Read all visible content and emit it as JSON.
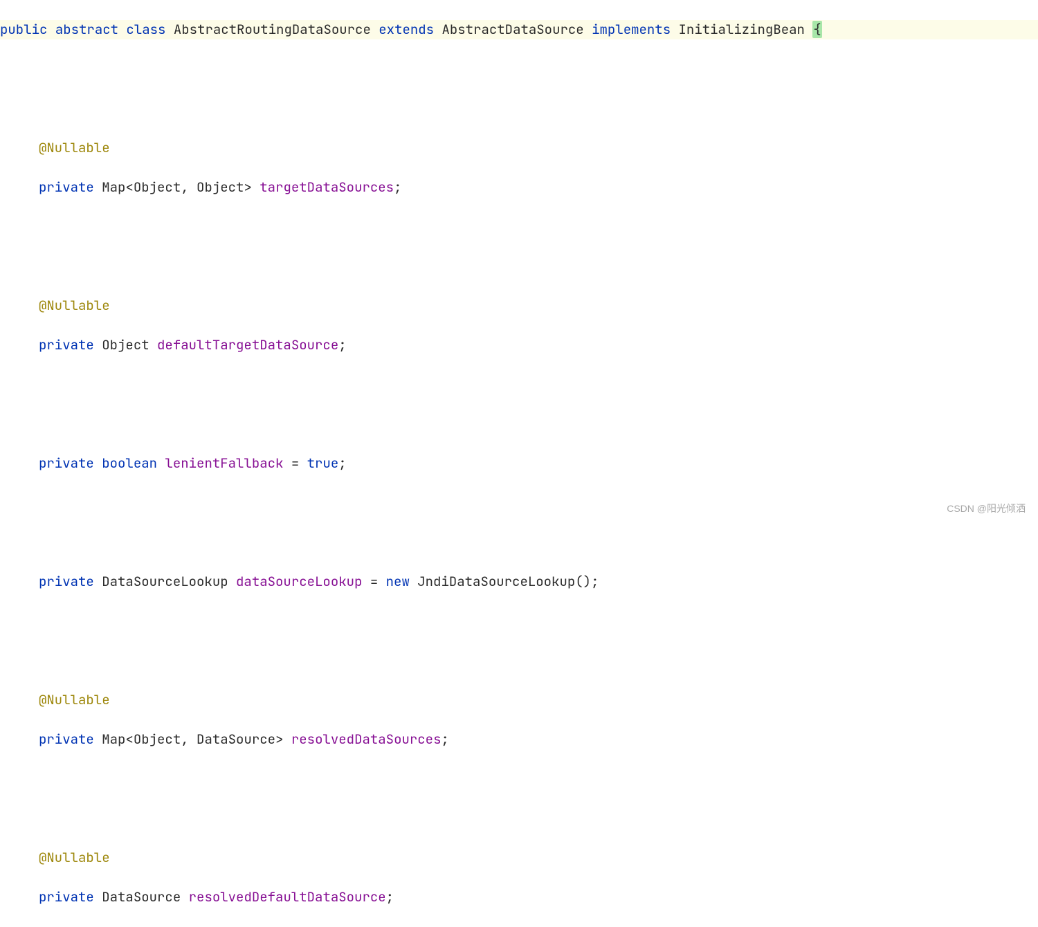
{
  "declaration": {
    "kw_public": "public",
    "kw_abstract": "abstract",
    "kw_class": "class",
    "class_name": "AbstractRoutingDataSource",
    "kw_extends": "extends",
    "super_class": "AbstractDataSource",
    "kw_implements": "implements",
    "interface_name": "InitializingBean",
    "open_brace": "{"
  },
  "fields": [
    {
      "annotation": "@Nullable",
      "kw_private": "private",
      "type": "Map",
      "generic_open": "<",
      "generic_arg1": "Object",
      "generic_sep": ", ",
      "generic_arg2": "Object",
      "generic_close": ">",
      "name": "targetDataSources",
      "semi": ";"
    },
    {
      "annotation": "@Nullable",
      "kw_private": "private",
      "type": "Object",
      "name": "defaultTargetDataSource",
      "semi": ";"
    },
    {
      "kw_private": "private",
      "type_kw": "boolean",
      "name": "lenientFallback",
      "eq": " = ",
      "value_kw": "true",
      "semi": ";"
    },
    {
      "kw_private": "private",
      "type": "DataSourceLookup",
      "name": "dataSourceLookup",
      "eq": " = ",
      "kw_new": "new",
      "ctor": "JndiDataSourceLookup",
      "parens": "()",
      "semi": ";"
    },
    {
      "annotation": "@Nullable",
      "kw_private": "private",
      "type": "Map",
      "generic_open": "<",
      "generic_arg1": "Object",
      "generic_sep": ", ",
      "generic_arg2": "DataSource",
      "generic_close": ">",
      "name": "resolvedDataSources",
      "semi": ";"
    },
    {
      "annotation": "@Nullable",
      "kw_private": "private",
      "type": "DataSource",
      "name": "resolvedDefaultDataSource",
      "semi": ";"
    }
  ],
  "watermark": "CSDN @阳光倾洒"
}
